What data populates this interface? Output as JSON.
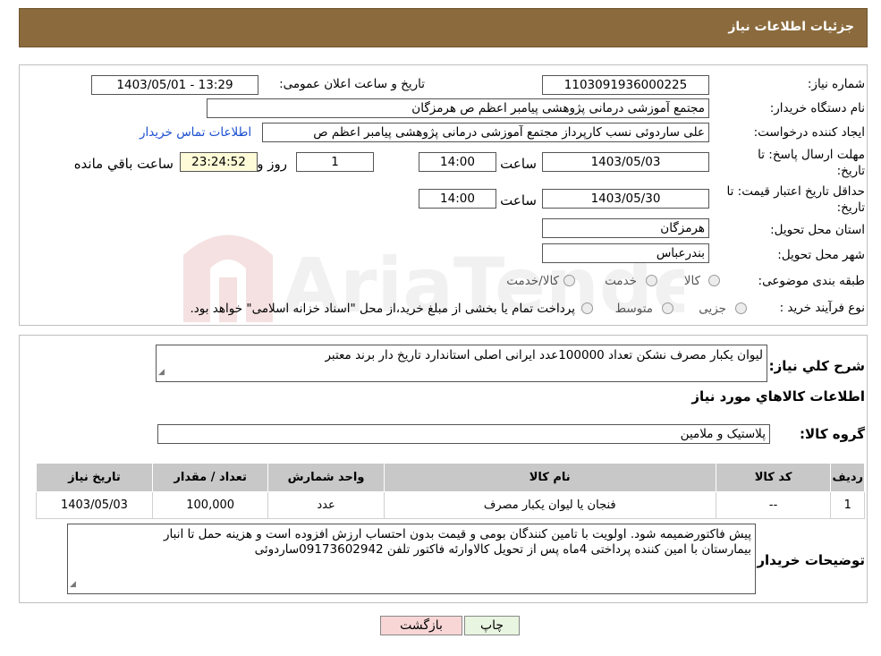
{
  "header": {
    "title": "جزئیات اطلاعات نیاز"
  },
  "fields": {
    "need_number": {
      "label": "شماره نیاز:",
      "value": "1103091936000225"
    },
    "announce_datetime": {
      "label": "تاریخ و ساعت اعلان عمومی:",
      "value": "1403/05/01 - 13:29"
    },
    "buyer_org": {
      "label": "نام دستگاه خریدار:",
      "value": "مجتمع آموزشی درمانی پژوهشی پیامبر اعظم ص  هرمزگان"
    },
    "requester": {
      "label": "ایجاد کننده درخواست:",
      "value": "علی ساردوئی نسب کارپرداز مجتمع آموزشی درمانی پژوهشی پیامبر اعظم ص"
    },
    "contact_link": "اطلاعات تماس خریدار",
    "reply_deadline": {
      "label_line1": "مهلت ارسال پاسخ: تا",
      "label_line2": "تاریخ:",
      "date": "1403/05/03",
      "time_label": "ساعت",
      "time": "14:00",
      "days": "1",
      "days_label": "روز و",
      "remaining": "23:24:52",
      "remaining_label": "ساعت باقي مانده"
    },
    "price_validity": {
      "label_line1": "حداقل تاریخ اعتبار قیمت: تا",
      "label_line2": "تاریخ:",
      "date": "1403/05/30",
      "time_label": "ساعت",
      "time": "14:00"
    },
    "province": {
      "label": "استان محل تحویل:",
      "value": "هرمزگان"
    },
    "city": {
      "label": "شهر محل تحویل:",
      "value": "بندرعباس"
    },
    "category": {
      "label": "طبقه بندی موضوعی:",
      "options": [
        "کالا",
        "خدمت",
        "کالا/خدمت"
      ]
    },
    "process": {
      "label": "نوع فرآیند خرید :",
      "options": [
        "جزیی",
        "متوسط"
      ],
      "note": "پرداخت تمام یا بخشی از مبلغ خرید،از محل \"اسناد خزانه اسلامی\" خواهد بود."
    }
  },
  "summary": {
    "label": "شرح كلي نياز:",
    "value": "لیوان یکبار مصرف نشکن تعداد 100000عدد ایرانی اصلی استاندارد تاریخ دار برند معتبر"
  },
  "goods_section_title": "اطلاعات كالاهاي مورد نياز",
  "goods_group": {
    "label": "گروه کالا:",
    "value": "پلاستیک و ملامین"
  },
  "table": {
    "headers": [
      "رديف",
      "کد کالا",
      "نام کالا",
      "واحد شمارش",
      "تعداد / مقدار",
      "تاریخ نیاز"
    ],
    "rows": [
      {
        "index": "1",
        "code": "--",
        "name": "فنجان یا لیوان یکبار مصرف",
        "unit": "عدد",
        "qty": "100,000",
        "date": "1403/05/03"
      }
    ]
  },
  "buyer_notes": {
    "label": "توضیحات خریدار:",
    "line1": "پیش فاکتورضمیمه شود. اولویت با تامین کنندگان بومی و قیمت بدون  احتساب ارزش افزوده است و هزینه حمل تا انبار",
    "line2": "بیمارستان با امین کننده پرداختی 4ماه پس از تحویل کالاوارئه فاکتور  تلفن 09173602942ساردوئی"
  },
  "buttons": {
    "print": "چاپ",
    "back": "بازگشت"
  },
  "watermark_text": "AriaTender.neT",
  "colors": {
    "header": "#8b6b3d",
    "link": "#1a4fd0",
    "back_button": "#f8d6d6",
    "print_button": "#e8f5e0",
    "remaining_box": "#fefbd8"
  }
}
